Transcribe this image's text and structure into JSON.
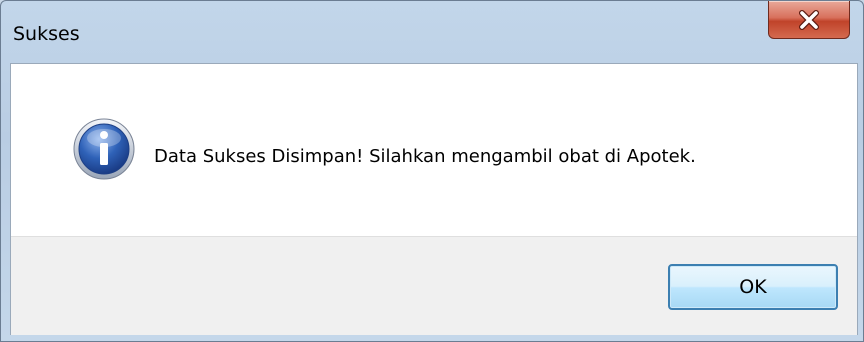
{
  "dialog": {
    "title": "Sukses",
    "message": "Data Sukses Disimpan! Silahkan mengambil obat di Apotek.",
    "ok_label": "OK",
    "icon": "info-icon",
    "close_icon": "close-icon"
  },
  "colors": {
    "titlebar": "#c2d6ea",
    "close_button": "#c7462c",
    "ok_border": "#3c7fb1",
    "info_icon": "#2f62b8"
  }
}
